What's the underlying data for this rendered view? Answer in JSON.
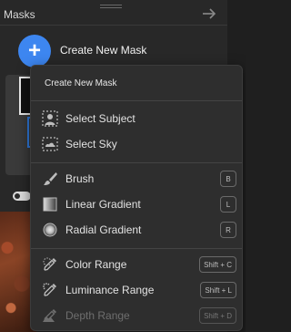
{
  "panel": {
    "title": "Masks",
    "create_label": "Create New Mask",
    "create_symbol": "+"
  },
  "menu": {
    "header": "Create New Mask",
    "items": [
      {
        "label": "Select Subject",
        "icon": "select-subject-icon"
      },
      {
        "label": "Select Sky",
        "icon": "select-sky-icon"
      },
      {
        "label": "Brush",
        "icon": "brush-icon",
        "shortcut": "B"
      },
      {
        "label": "Linear Gradient",
        "icon": "linear-gradient-icon",
        "shortcut": "L"
      },
      {
        "label": "Radial Gradient",
        "icon": "radial-gradient-icon",
        "shortcut": "R"
      },
      {
        "label": "Color Range",
        "icon": "color-range-icon",
        "shortcut": "Shift + C"
      },
      {
        "label": "Luminance Range",
        "icon": "luminance-range-icon",
        "shortcut": "Shift + L"
      },
      {
        "label": "Depth Range",
        "icon": "depth-range-icon",
        "shortcut": "Shift + D",
        "disabled": true
      }
    ]
  },
  "colors": {
    "accent": "#3d86f0",
    "panel_bg": "#282828",
    "menu_bg": "#2e2e2e",
    "disabled_text": "#6e6e6e"
  }
}
